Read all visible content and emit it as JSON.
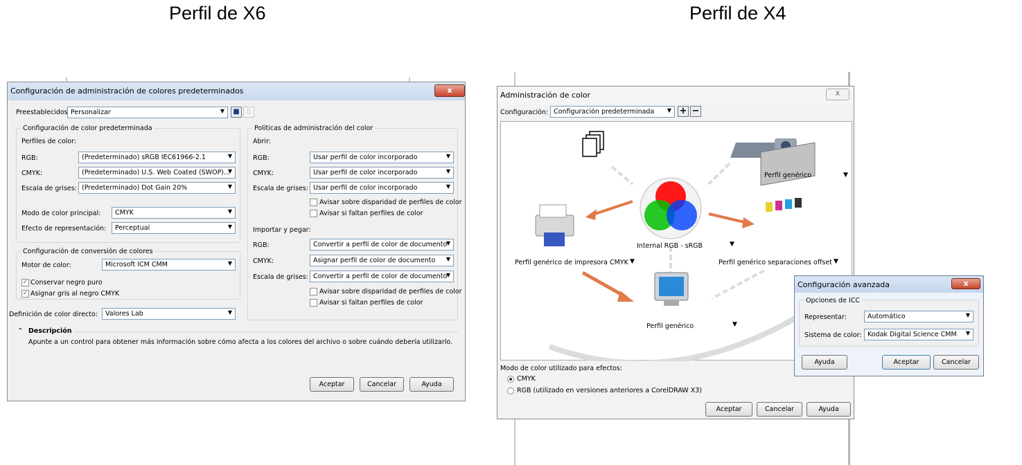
{
  "headings": {
    "left": "Perfil de X6",
    "right": "Perfil de X4"
  },
  "x6": {
    "title": "Configuración de administración de colores predeterminados",
    "close": "x",
    "preset_label": "Preestablecidos:",
    "preset_value": "Personalizar",
    "default_group": "Configuración de color predeterminada",
    "profiles_label": "Perfiles de color:",
    "rgb_label": "RGB:",
    "rgb_value": "(Predeterminado) sRGB IEC61966-2.1",
    "cmyk_label": "CMYK:",
    "cmyk_value": "(Predeterminado) U.S. Web Coated (SWOP)...",
    "gray_label": "Escala de grises:",
    "gray_value": "(Predeterminado) Dot Gain 20%",
    "mode_label": "Modo de color principal:",
    "mode_value": "CMYK",
    "render_label": "Efecto de representación:",
    "render_value": "Perceptual",
    "conv_group": "Configuración de conversión de colores",
    "engine_label": "Motor de color:",
    "engine_value": "Microsoft ICM CMM",
    "preserve_black": "Conservar negro puro",
    "gray_to_black": "Asignar gris al negro CMYK",
    "spot_label": "Definición de color directo:",
    "spot_value": "Valores Lab",
    "policy_group": "Políticas de administración del color",
    "open_label": "Abrir:",
    "p_rgb_label": "RGB:",
    "p_rgb_value": "Usar perfil de color incorporado",
    "p_cmyk_label": "CMYK:",
    "p_cmyk_value": "Usar perfil de color incorporado",
    "p_gray_label": "Escala de grises:",
    "p_gray_value": "Usar perfil de color incorporado",
    "warn_mismatch": "Avisar sobre disparidad de perfiles de color",
    "warn_missing": "Avisar si faltan perfiles de color",
    "import_label": "Importar y pegar:",
    "i_rgb_label": "RGB:",
    "i_rgb_value": "Convertir a perfil de color de documento",
    "i_cmyk_label": "CMYK:",
    "i_cmyk_value": "Asignar perfil de color de documento",
    "i_gray_label": "Escala de grises:",
    "i_gray_value": "Convertir a perfil de color de documento",
    "warn_mismatch2": "Avisar sobre disparidad de perfiles de color",
    "warn_missing2": "Avisar si faltan perfiles de color",
    "desc_title": "Descripción",
    "desc_text": "Apunte a un control para obtener más información sobre cómo afecta a los colores del archivo o sobre cuándo debería utilizarlo.",
    "ok": "Aceptar",
    "cancel": "Cancelar",
    "help": "Ayuda"
  },
  "x4": {
    "title": "Administración de color",
    "close": "X",
    "config_label": "Configuración:",
    "config_value": "Configuración predeterminada",
    "generic_profile_top": "Perfil genérico",
    "internal": "Internal RGB - sRGB",
    "printer": "Perfil genérico de impresora CMYK",
    "offset": "Perfil genérico separaciones offset",
    "monitor": "Perfil genérico",
    "mode_label": "Modo de color utilizado para efectos:",
    "mode_cmyk": "CMYK",
    "mode_rgb": "RGB (utilizado en versiones anteriores a CorelDRAW X3)",
    "ok": "Aceptar",
    "cancel": "Cancelar",
    "help": "Ayuda"
  },
  "adv": {
    "title": "Configuración avanzada",
    "close": "x",
    "icc_group": "Opciones de ICC",
    "render_label": "Representar:",
    "render_value": "Automático",
    "system_label": "Sistema de color:",
    "system_value": "Kodak Digital Science CMM",
    "help": "Ayuda",
    "ok": "Aceptar",
    "cancel": "Cancelar"
  },
  "colors": {
    "arrow": "#e07a4a",
    "ghost_arrow": "#dcdcdc",
    "accent": "#2a5aa8"
  }
}
